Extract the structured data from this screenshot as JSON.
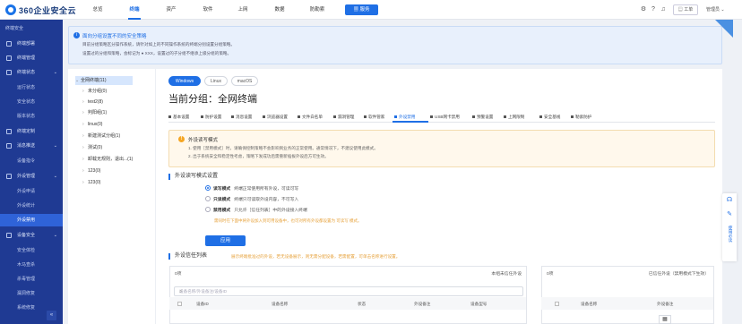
{
  "brand": {
    "name": "360企业安全云"
  },
  "topnav": [
    {
      "label": "总览"
    },
    {
      "label": "终端"
    },
    {
      "label": "资产"
    },
    {
      "label": "软件"
    },
    {
      "label": "上网"
    },
    {
      "label": "数据"
    },
    {
      "label": "防勒索"
    }
  ],
  "service_button": "服务",
  "ticket_label": "工单",
  "user_label": "管理员",
  "sidebar": {
    "header": "终端安全",
    "items": [
      {
        "label": "终端部署",
        "arrow": ""
      },
      {
        "label": "终端管理",
        "arrow": ""
      },
      {
        "label": "终端状态",
        "arrow": "⌄"
      },
      {
        "label": "运行状态",
        "sub": true
      },
      {
        "label": "安全状态",
        "sub": true
      },
      {
        "label": "版本状态",
        "sub": true
      },
      {
        "label": "终端定制",
        "arrow": ""
      },
      {
        "label": "消息推送",
        "arrow": "⌄"
      },
      {
        "label": "设备指令",
        "sub": true
      },
      {
        "label": "外设管理",
        "arrow": "⌄"
      },
      {
        "label": "外设申请",
        "sub": true
      },
      {
        "label": "外设统计",
        "sub": true
      },
      {
        "label": "外设禁用",
        "sub": true
      },
      {
        "label": "设备安全",
        "arrow": "⌄"
      },
      {
        "label": "安全体检",
        "sub": true
      },
      {
        "label": "木马查杀",
        "sub": true
      },
      {
        "label": "杀毒管理",
        "sub": true
      },
      {
        "label": "漏洞修复",
        "sub": true
      },
      {
        "label": "系统修复",
        "sub": true
      }
    ],
    "collapse_icon": "«"
  },
  "notice": {
    "title": "面向分组设置不同的安全策略",
    "lines": [
      "目前分组策略区分操作系统，请针对如上的不同操作系统的终端分别设置分组策略。",
      "设置过的分组和策略，会标记为 ● XXX，设置过的子分组不继承上级分组的策略。"
    ]
  },
  "tree": {
    "items": [
      {
        "toggle": "⌄",
        "label": "全网终端(11)",
        "selected": true
      },
      {
        "toggle": "",
        "label": "未分组(0)"
      },
      {
        "toggle": "",
        "label": "test2(8)"
      },
      {
        "toggle": "",
        "label": "判阳组(1)"
      },
      {
        "toggle": "",
        "label": "linux(0)"
      },
      {
        "toggle": "",
        "label": "新建测试分组(1)"
      },
      {
        "toggle": "",
        "label": "测试(0)"
      },
      {
        "toggle": "",
        "label": "卸载无规则，退出...(1)"
      },
      {
        "toggle": "",
        "label": "123(0)"
      },
      {
        "toggle": "",
        "label": "123(0)"
      }
    ]
  },
  "os_tabs": [
    {
      "label": "Windows",
      "active": true
    },
    {
      "label": "Linux",
      "active": false
    },
    {
      "label": "macOS",
      "active": false
    }
  ],
  "group_title": "当前分组：全网终端",
  "policy_tabs": [
    {
      "label": "基本设置"
    },
    {
      "label": "防护设置"
    },
    {
      "label": "消息设置"
    },
    {
      "label": "浏览器设置"
    },
    {
      "label": "文件白名单"
    },
    {
      "label": "漏洞管理"
    },
    {
      "label": "软件管家"
    },
    {
      "label": "外设禁用",
      "active": true
    },
    {
      "label": "USB网卡禁用"
    },
    {
      "label": "预警设置"
    },
    {
      "label": "上网限制"
    },
    {
      "label": "安全基线"
    },
    {
      "label": "勒索防护"
    }
  ],
  "warning": {
    "title": "外设读写模式",
    "lines": [
      "1. 使用［禁用模式］时，请确保控制策略不会影响到业务的正常使用。通常情况下，不建议使用此模式。",
      "2. 出于系统安全和稳定性考虑，策略下发成功后需重新插拔外设后方可生效。"
    ]
  },
  "rw_section": {
    "title": "外设读写模式设置",
    "options": [
      {
        "name": "读写模式",
        "desc": "终端正常使用所有外设，可读可写",
        "checked": true
      },
      {
        "name": "只读模式",
        "desc": "终端只可读取外设内容，不可写入",
        "checked": false
      },
      {
        "name": "禁用模式",
        "desc": "只允许［信任列表］中的外设接入终端",
        "checked": false
      }
    ],
    "hint": "需同时在下面中将外设加入到可用设备中，也可对所有外设都设置为 可读写 模式。"
  },
  "apply_button": "应用",
  "list_section": {
    "title": "外设信任列表",
    "hint": "展示终端批准过的外设，若无设备展示，则无需分配设备，若需配置，可单击名称进行设置。"
  },
  "left_box": {
    "count": "0项",
    "header_right": "本组未信任外设",
    "search_placeholder": "设备名称/外设备注/设备ID",
    "columns": [
      "设备ID",
      "设备名称",
      "状态",
      "外设备注",
      "设备型号"
    ]
  },
  "right_box": {
    "count": "0项",
    "header_right": "已信任外设（禁用模式下生效）",
    "columns": [
      "设备名称",
      "外设备注"
    ]
  },
  "right_dock": {
    "vertical_text": "使用必读"
  }
}
